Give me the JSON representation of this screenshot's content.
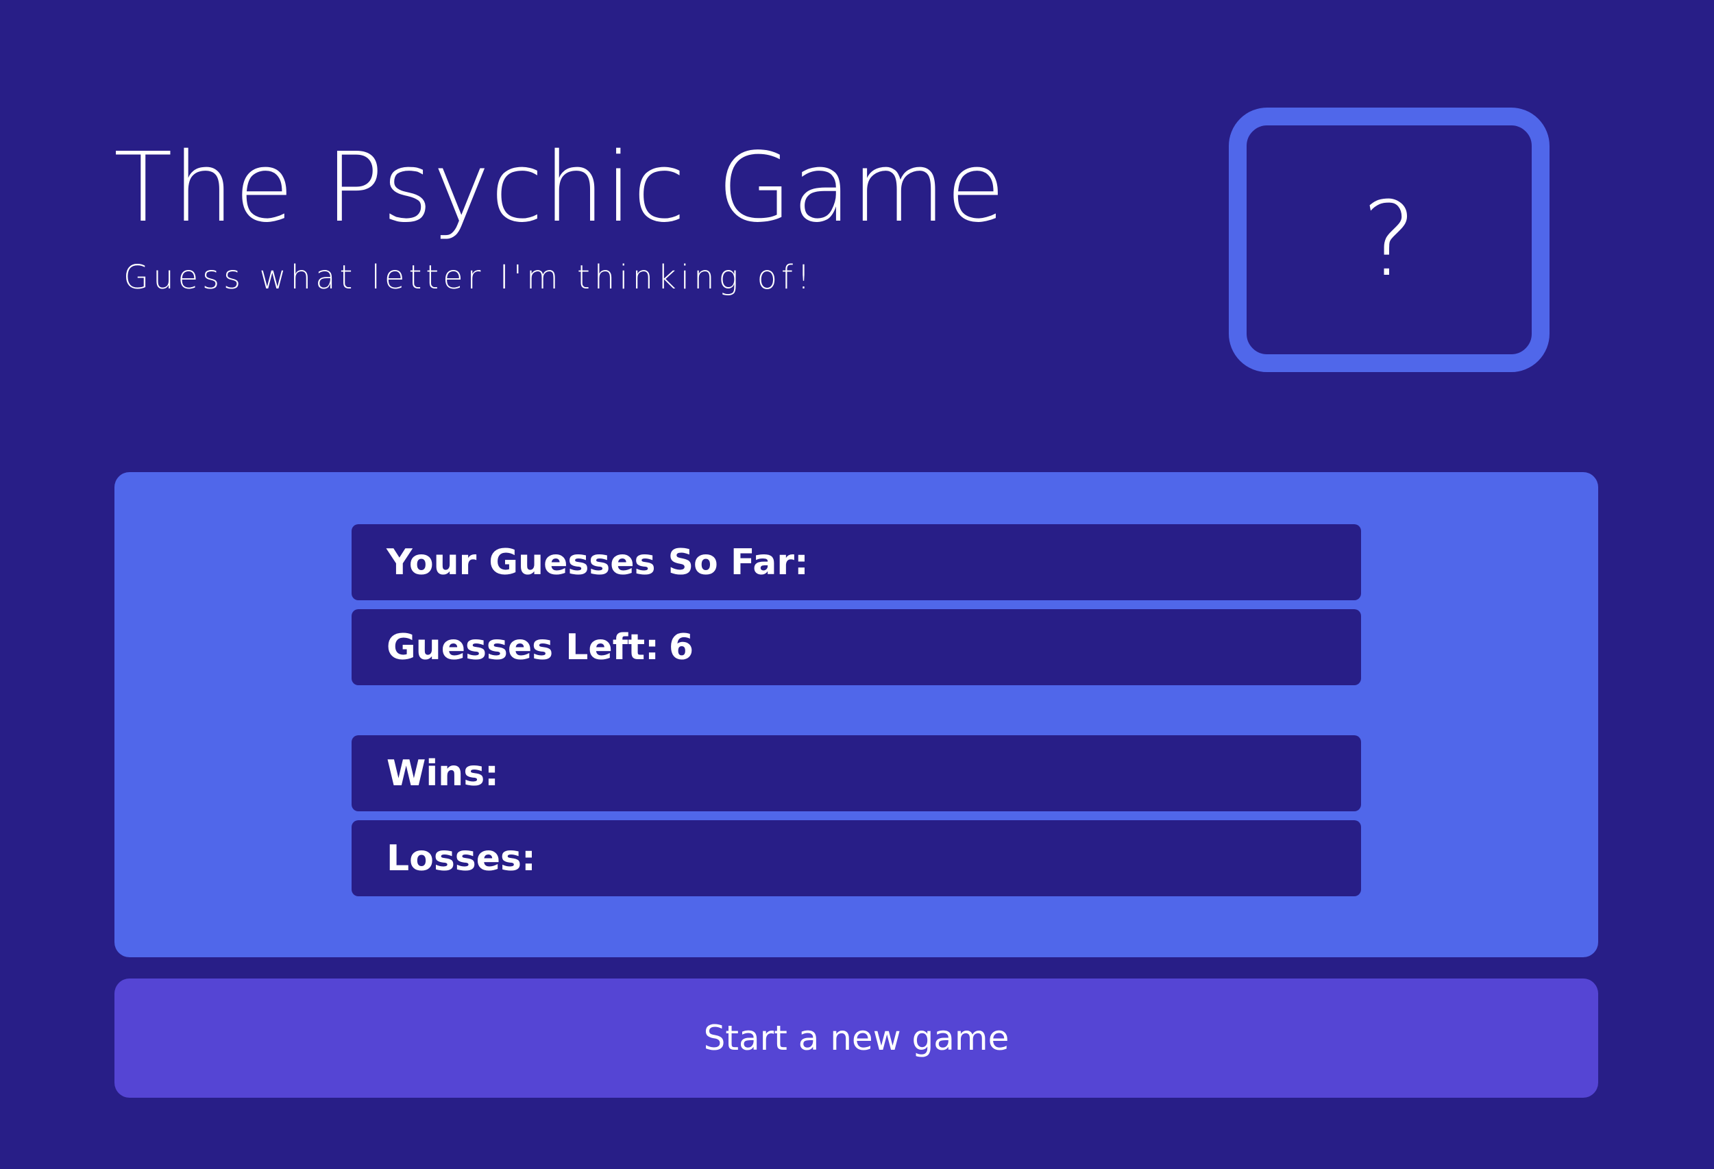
{
  "header": {
    "title": "The Psychic Game",
    "subtitle": "Guess what letter I'm thinking of!"
  },
  "mystery_card": {
    "glyph": "?"
  },
  "stats": {
    "guesses_so_far_label": "Your Guesses So Far:",
    "guesses_so_far_value": "",
    "guesses_left_label": "Guesses Left:",
    "guesses_left_value": "6",
    "wins_label": "Wins:",
    "wins_value": "",
    "losses_label": "Losses:",
    "losses_value": ""
  },
  "actions": {
    "new_game_label": "Start a new game"
  },
  "colors": {
    "background": "#281e87",
    "accent": "#5067ea",
    "button": "#5545d4",
    "text": "#ffffff"
  }
}
